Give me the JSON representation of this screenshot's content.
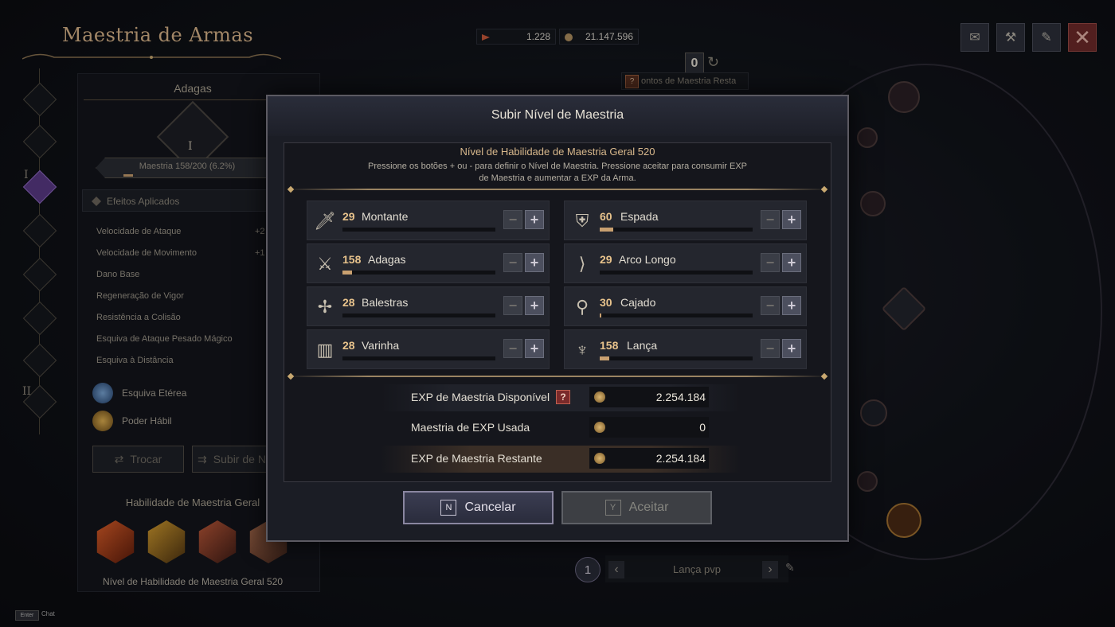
{
  "header": {
    "title": "Maestria de Armas",
    "currency1": "1.228",
    "currency2": "21.147.596",
    "remaining_points": "0",
    "remaining_label": "ontos de Maestria Resta"
  },
  "left_panel": {
    "weapon_title": "Adagas",
    "weapon_rank": "I",
    "mastery_label": "Maestria 158/200 (6.2%)",
    "mastery_progress": 0.062,
    "effects_header": "Efeitos Aplicados",
    "stats": [
      {
        "label": "Velocidade de Ataque",
        "value": "+2"
      },
      {
        "label": "Velocidade de Movimento",
        "value": "+1"
      },
      {
        "label": "Dano Base",
        "value": ""
      },
      {
        "label": "Regeneração de Vigor",
        "value": ""
      },
      {
        "label": "Resistência a Colisão",
        "value": ""
      },
      {
        "label": "Esquiva de Ataque Pesado Mágico",
        "value": ""
      },
      {
        "label": "Esquiva à Distância",
        "value": ""
      }
    ],
    "skills": [
      {
        "label": "Esquiva Etérea"
      },
      {
        "label": "Poder Hábil"
      }
    ],
    "swap_button": "Trocar",
    "upgrade_button": "Subir de N",
    "general_title": "Habilidade de Maestria Geral",
    "general_footer": "Nível de Habilidade de Maestria Geral 520",
    "roman_one": "I",
    "roman_two": "II"
  },
  "bottom_bar": {
    "index": "1",
    "label": "Lança pvp"
  },
  "chat": {
    "key": "Enter",
    "label": "Chat"
  },
  "modal": {
    "title": "Subir Nível de Maestria",
    "level_title": "Nível de Habilidade de Maestria Geral 520",
    "description_line1": "Pressione os botões + ou - para definir o Nível de Maestria. Pressione aceitar para consumir EXP",
    "description_line2": "de Maestria e aumentar a EXP da Arma.",
    "weapons": [
      {
        "level": "29",
        "name": "Montante",
        "icon": "greatsword-icon",
        "progress": 0.0
      },
      {
        "level": "60",
        "name": "Espada",
        "icon": "sword-shield-icon",
        "progress": 0.09
      },
      {
        "level": "158",
        "name": "Adagas",
        "icon": "daggers-icon",
        "progress": 0.06
      },
      {
        "level": "29",
        "name": "Arco Longo",
        "icon": "longbow-icon",
        "progress": 0.0
      },
      {
        "level": "28",
        "name": "Balestras",
        "icon": "crossbow-icon",
        "progress": 0.0
      },
      {
        "level": "30",
        "name": "Cajado",
        "icon": "staff-icon",
        "progress": 0.01
      },
      {
        "level": "28",
        "name": "Varinha",
        "icon": "wand-icon",
        "progress": 0.0
      },
      {
        "level": "158",
        "name": "Lança",
        "icon": "spear-icon",
        "progress": 0.06
      }
    ],
    "minus": "−",
    "plus": "+",
    "exp_available_label": "EXP de Maestria Disponível",
    "exp_available_value": "2.254.184",
    "exp_used_label": "Maestria de EXP Usada",
    "exp_used_value": "0",
    "exp_remaining_label": "EXP de Maestria Restante",
    "exp_remaining_value": "2.254.184",
    "help_glyph": "?",
    "cancel_key": "N",
    "cancel_label": "Cancelar",
    "accept_key": "Y",
    "accept_label": "Aceitar"
  }
}
